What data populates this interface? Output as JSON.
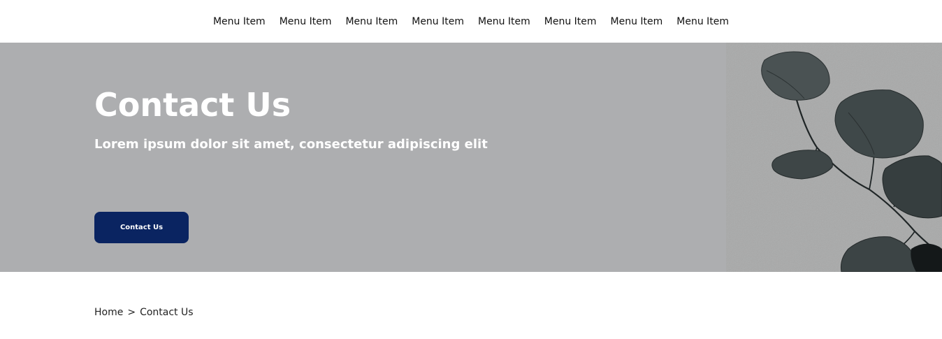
{
  "nav": {
    "items": [
      {
        "label": "Menu Item"
      },
      {
        "label": "Menu Item"
      },
      {
        "label": "Menu Item"
      },
      {
        "label": "Menu Item"
      },
      {
        "label": "Menu Item"
      },
      {
        "label": "Menu Item"
      },
      {
        "label": "Menu Item"
      },
      {
        "label": "Menu Item"
      }
    ]
  },
  "hero": {
    "title": "Contact Us",
    "subtitle": "Lorem ipsum dolor sit amet, consectetur adipiscing elit",
    "button_label": "Contact Us",
    "background_color": "#adaeb0",
    "button_color": "#0a2461",
    "image_icon": "eucalyptus-leaves-image"
  },
  "breadcrumb": {
    "home": "Home",
    "separator": ">",
    "current": "Contact Us"
  }
}
